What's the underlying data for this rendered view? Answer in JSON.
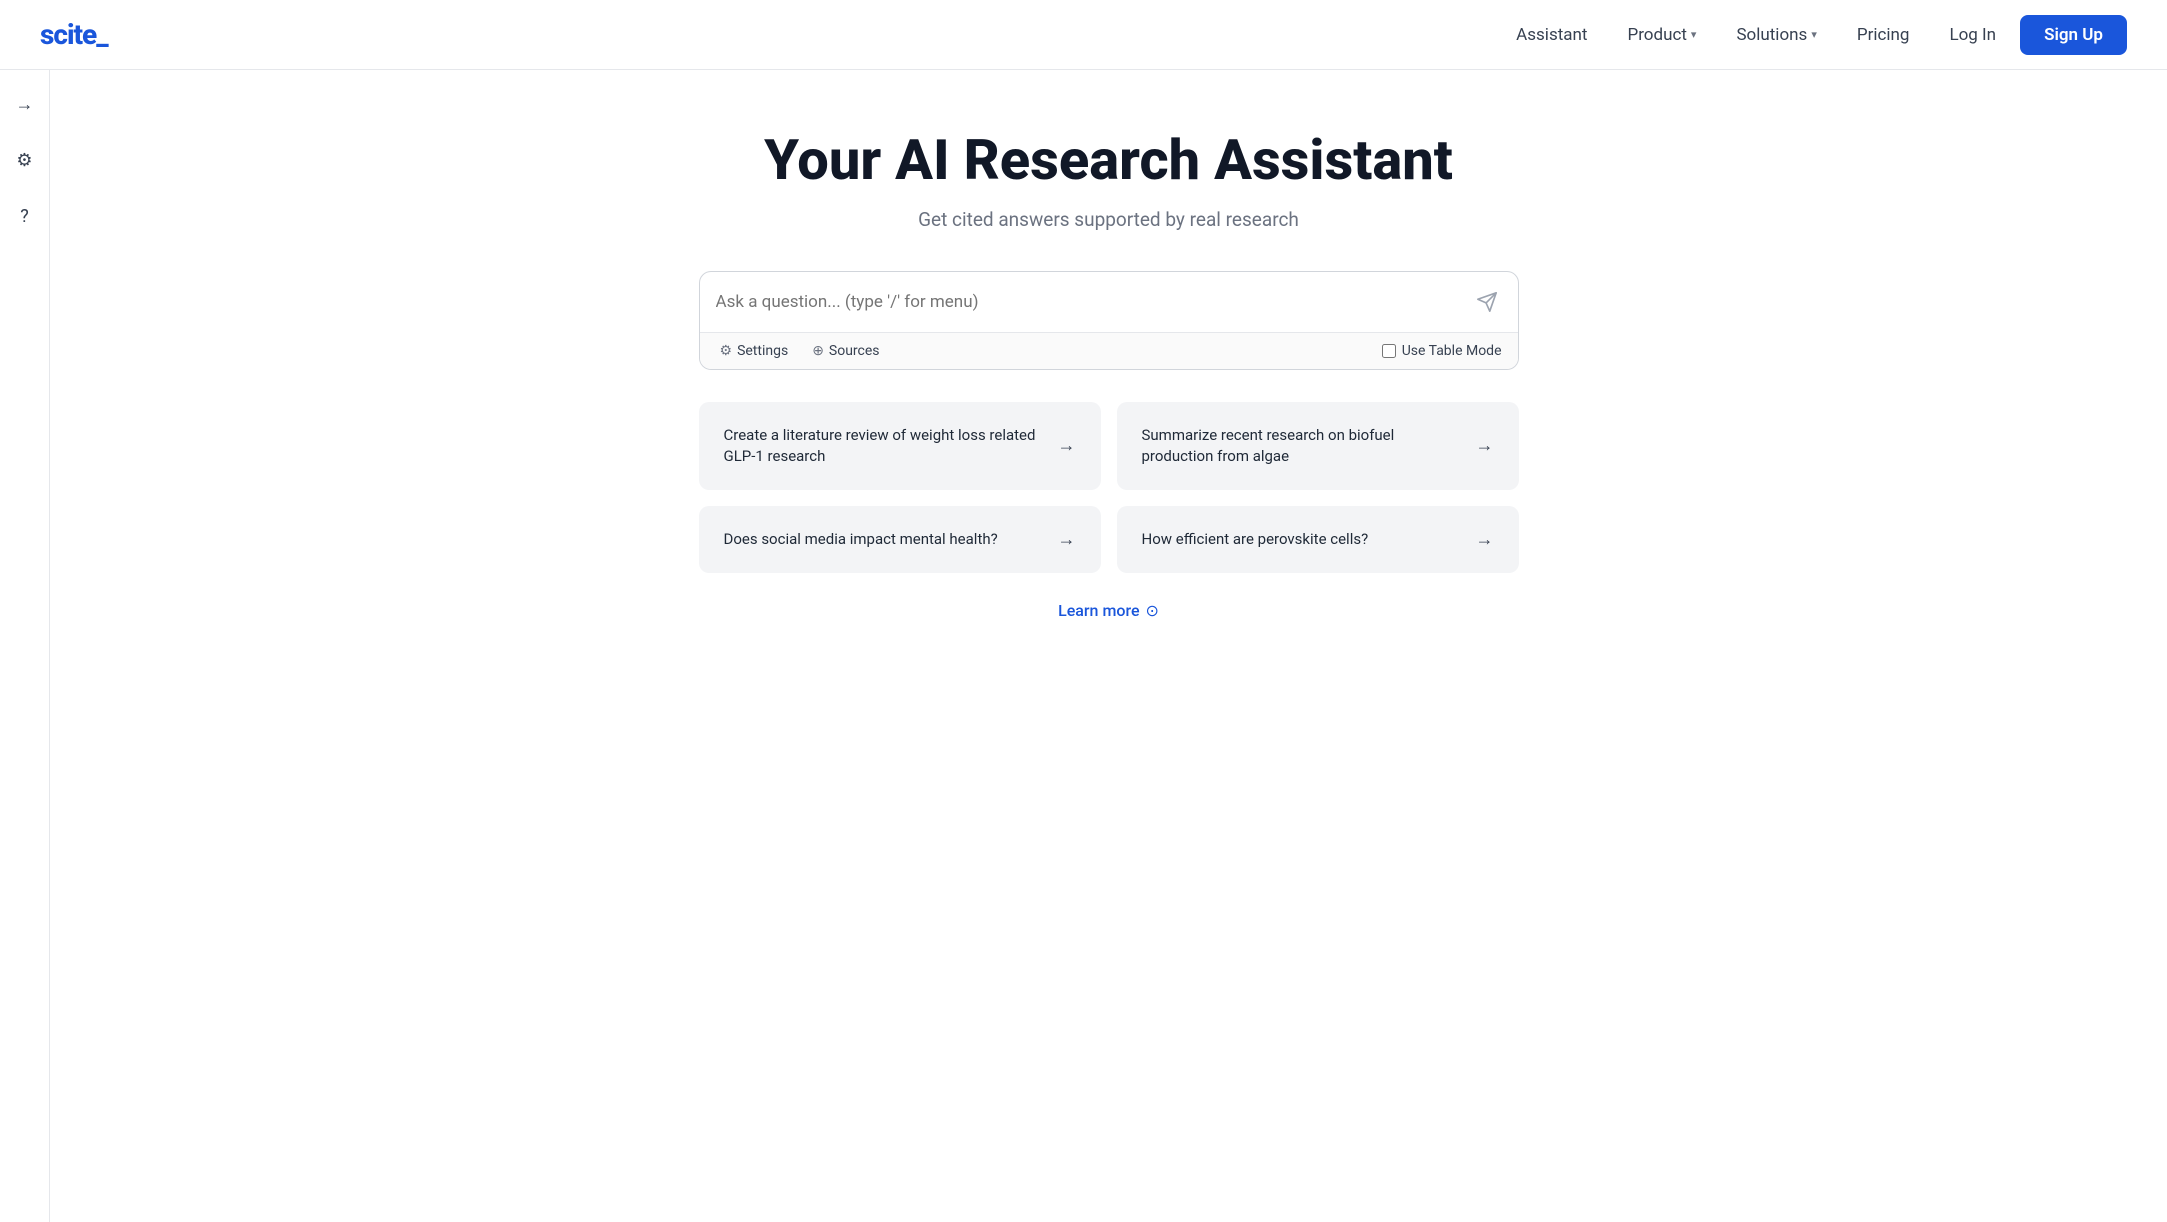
{
  "brand": {
    "logo": "scite_",
    "logo_color": "#1a56db"
  },
  "nav": {
    "assistant_label": "Assistant",
    "product_label": "Product",
    "solutions_label": "Solutions",
    "pricing_label": "Pricing",
    "login_label": "Log In",
    "signup_label": "Sign Up"
  },
  "sidebar": {
    "arrow_icon": "→",
    "settings_icon": "⚙",
    "help_icon": "?"
  },
  "hero": {
    "title": "Your AI Research Assistant",
    "subtitle": "Get cited answers supported by real research"
  },
  "search": {
    "placeholder": "Ask a question... (type '/' for menu)",
    "settings_label": "Settings",
    "sources_label": "Sources",
    "table_mode_label": "Use Table Mode"
  },
  "suggestions": [
    {
      "text": "Create a literature review of weight loss related GLP-1 research",
      "arrow": "→"
    },
    {
      "text": "Summarize recent research on biofuel production from algae",
      "arrow": "→"
    },
    {
      "text": "Does social media impact mental health?",
      "arrow": "→"
    },
    {
      "text": "How efficient are perovskite cells?",
      "arrow": "→"
    }
  ],
  "learn_more": {
    "label": "Learn more",
    "icon": "⊙"
  }
}
